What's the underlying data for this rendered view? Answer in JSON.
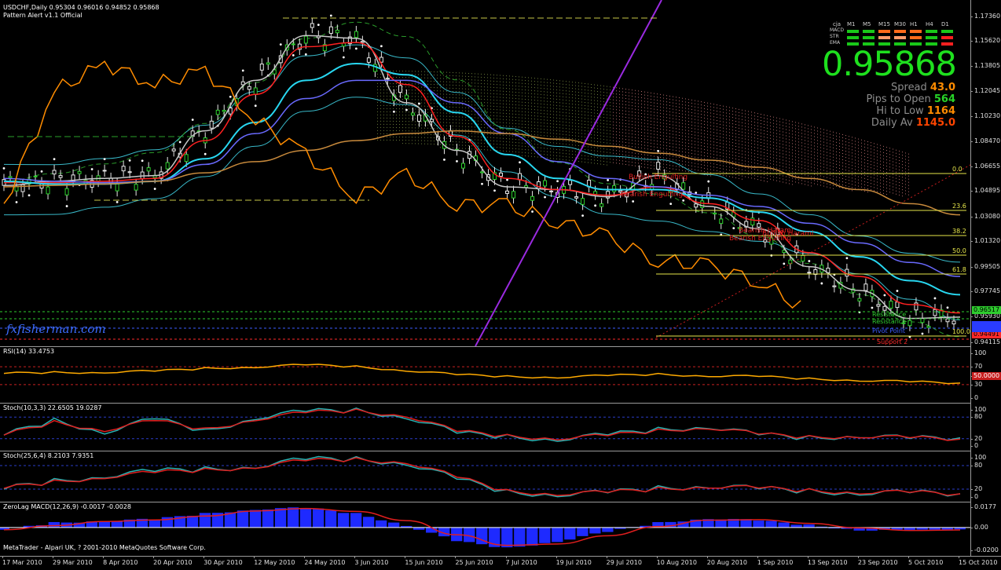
{
  "header": {
    "symbol_line": "USDCHF,Daily  0.95304 0.96016 0.94852 0.95868",
    "indicator_line": "Pattern Alert v1.1 Official"
  },
  "dashboard": {
    "brand": "cja",
    "timeframes": [
      "M1",
      "M5",
      "M15",
      "M30",
      "H1",
      "H4",
      "D1"
    ],
    "rows": [
      {
        "label": "MACD",
        "colors": [
          "#19c819",
          "#19c819",
          "#ff6a1a",
          "#ff6a1a",
          "#ff6a1a",
          "#19c819",
          "#19c819"
        ]
      },
      {
        "label": "STR",
        "colors": [
          "#19c819",
          "#19c819",
          "#ff9a6a",
          "#ff9a6a",
          "#ff6a1a",
          "#19c819",
          "#ff2020"
        ]
      },
      {
        "label": "EMA",
        "colors": [
          "#19c819",
          "#19c819",
          "#19c819",
          "#19c819",
          "#19c819",
          "#19c819",
          "#ff2020"
        ]
      }
    ]
  },
  "big_price": "0.95868",
  "info": [
    {
      "label": "Spread",
      "value": "43.0",
      "color": "#ff8c00"
    },
    {
      "label": "Pips to Open",
      "value": "564",
      "color": "#28d428"
    },
    {
      "label": "Hi to Low",
      "value": "1164",
      "color": "#ff8c00"
    },
    {
      "label": "Daily Av",
      "value": "1145.0",
      "color": "#ff4500"
    }
  ],
  "watermark": "fxfisherman.com",
  "copyright": "MetaTrader - Alpari UK, ? 2001-2010 MetaQuotes Software Corp.",
  "price_axis": [
    "1.17360",
    "1.15620",
    "1.13805",
    "1.12045",
    "1.10230",
    "1.08470",
    "1.06655",
    "1.04895",
    "1.03080",
    "1.01320",
    "0.99505",
    "0.97745",
    "0.95930",
    "0.94115"
  ],
  "price_tags": [
    {
      "text": "0.96517",
      "color": "#2ecc2e"
    },
    {
      "text": "0.94491",
      "color": "#ff2a2a"
    }
  ],
  "fib_levels": [
    "0.0",
    "23.6",
    "38.2",
    "50.0",
    "61.8",
    "100.0"
  ],
  "level_labels": [
    {
      "text": "Resistance",
      "color": "#2ecc2e"
    },
    {
      "text": "Resistance",
      "color": "#2ecc2e"
    },
    {
      "text": "Pivot Point",
      "color": "#3c5cff"
    },
    {
      "text": "Support 2",
      "color": "#ff2a2a"
    }
  ],
  "pattern_labels": [
    "Bullish Engulfing",
    "Bearish Engulfing",
    "Bearish Harami",
    "Bearish Engulfing",
    "Bullish Harami"
  ],
  "panes": {
    "rsi": {
      "label": "RSI(14) 33.4753",
      "axis": [
        "100",
        "70",
        "50",
        "30",
        "0"
      ],
      "tag": "50.0000"
    },
    "stoch1": {
      "label": "Stoch(10,3,3) 22.6505 19.0287",
      "axis": [
        "100",
        "80",
        "20",
        "0"
      ]
    },
    "stoch2": {
      "label": "Stoch(25,6,4) 8.2103 7.9351",
      "axis": [
        "100",
        "80",
        "20",
        "0"
      ]
    },
    "macd": {
      "label": "ZeroLag MACD(12,26,9) -0.0017 -0.0028",
      "axis": [
        "0.0177",
        "0.00",
        "-0.0200"
      ]
    }
  },
  "date_axis": [
    "17 Mar 2010",
    "29 Mar 2010",
    "8 Apr 2010",
    "20 Apr 2010",
    "30 Apr 2010",
    "12 May 2010",
    "24 May 2010",
    "3 Jun 2010",
    "15 Jun 2010",
    "25 Jun 2010",
    "7 Jul 2010",
    "19 Jul 2010",
    "29 Jul 2010",
    "10 Aug 2010",
    "20 Aug 2010",
    "1 Sep 2010",
    "13 Sep 2010",
    "23 Sep 2010",
    "5 Oct 2010",
    "15 Oct 2010"
  ],
  "chart_data": {
    "type": "line",
    "symbol": "USDCHF",
    "timeframe": "Daily",
    "ohlc_last": {
      "open": 0.95304,
      "high": 0.96016,
      "low": 0.94852,
      "close": 0.95868
    },
    "x": [
      "17 Mar 2010",
      "29 Mar 2010",
      "8 Apr 2010",
      "20 Apr 2010",
      "30 Apr 2010",
      "12 May 2010",
      "24 May 2010",
      "3 Jun 2010",
      "15 Jun 2010",
      "25 Jun 2010",
      "7 Jul 2010",
      "19 Jul 2010",
      "29 Jul 2010",
      "10 Aug 2010",
      "20 Aug 2010",
      "1 Sep 2010",
      "13 Sep 2010",
      "23 Sep 2010",
      "5 Oct 2010",
      "15 Oct 2010"
    ],
    "ylim": [
      0.941,
      1.182
    ],
    "series": [
      {
        "color": "#c8c8c8",
        "values": [
          1.053,
          1.056,
          1.058,
          1.06,
          1.092,
          1.128,
          1.16,
          1.158,
          1.112,
          1.078,
          1.052,
          1.05,
          1.045,
          1.06,
          1.038,
          1.022,
          0.995,
          0.978,
          0.958,
          0.959
        ]
      },
      {
        "color": "#ff2020",
        "values": [
          1.055,
          1.055,
          1.056,
          1.058,
          1.085,
          1.118,
          1.152,
          1.155,
          1.125,
          1.088,
          1.058,
          1.05,
          1.046,
          1.052,
          1.04,
          1.028,
          1.005,
          0.988,
          0.968,
          0.962
        ]
      },
      {
        "color": "#28d7f0",
        "values": [
          1.056,
          1.054,
          1.054,
          1.056,
          1.072,
          1.098,
          1.128,
          1.14,
          1.132,
          1.105,
          1.075,
          1.058,
          1.05,
          1.05,
          1.044,
          1.034,
          1.02,
          1.002,
          0.985,
          0.975
        ]
      },
      {
        "color": "#6a6aff",
        "values": [
          1.058,
          1.056,
          1.055,
          1.056,
          1.068,
          1.09,
          1.115,
          1.128,
          1.128,
          1.112,
          1.09,
          1.07,
          1.058,
          1.052,
          1.046,
          1.038,
          1.026,
          1.012,
          0.998,
          0.988
        ]
      },
      {
        "color": "#c88a3c",
        "values": [
          1.052,
          1.053,
          1.054,
          1.056,
          1.062,
          1.07,
          1.078,
          1.085,
          1.09,
          1.092,
          1.09,
          1.086,
          1.081,
          1.076,
          1.071,
          1.066,
          1.058,
          1.05,
          1.04,
          1.032
        ]
      },
      {
        "color": "#ff8c00",
        "values": [
          1.04,
          1.12,
          1.14,
          1.125,
          1.135,
          1.1,
          1.075,
          1.045,
          1.06,
          1.04,
          1.038,
          1.028,
          1.015,
          1.0,
          0.995,
          0.985,
          0.962,
          null,
          null,
          null
        ]
      }
    ],
    "rsi": [
      55,
      57,
      58,
      60,
      66,
      70,
      74,
      70,
      62,
      52,
      48,
      47,
      50,
      53,
      50,
      48,
      43,
      40,
      36,
      33.5
    ],
    "stoch_fast": [
      [
        30,
        70,
        40,
        75,
        40,
        80,
        95,
        98,
        82,
        35,
        25,
        20,
        30,
        45,
        55,
        30,
        22,
        30,
        20,
        22.65
      ],
      [
        30,
        65,
        45,
        70,
        45,
        75,
        92,
        97,
        85,
        40,
        27,
        22,
        28,
        42,
        52,
        32,
        24,
        28,
        22,
        19.03
      ]
    ],
    "stoch_slow": [
      [
        20,
        40,
        55,
        65,
        70,
        80,
        95,
        96,
        88,
        45,
        12,
        8,
        10,
        22,
        30,
        20,
        15,
        12,
        10,
        8.21
      ],
      [
        22,
        38,
        52,
        62,
        68,
        78,
        92,
        95,
        90,
        50,
        14,
        9,
        11,
        20,
        28,
        22,
        16,
        13,
        11,
        7.94
      ]
    ],
    "zerolag_macd": [
      -0.002,
      0.004,
      0.006,
      0.007,
      0.012,
      0.016,
      0.017,
      0.012,
      0.002,
      -0.012,
      -0.018,
      -0.012,
      -0.004,
      0.004,
      0.008,
      0.006,
      0.002,
      -0.002,
      -0.003,
      -0.0017
    ]
  }
}
